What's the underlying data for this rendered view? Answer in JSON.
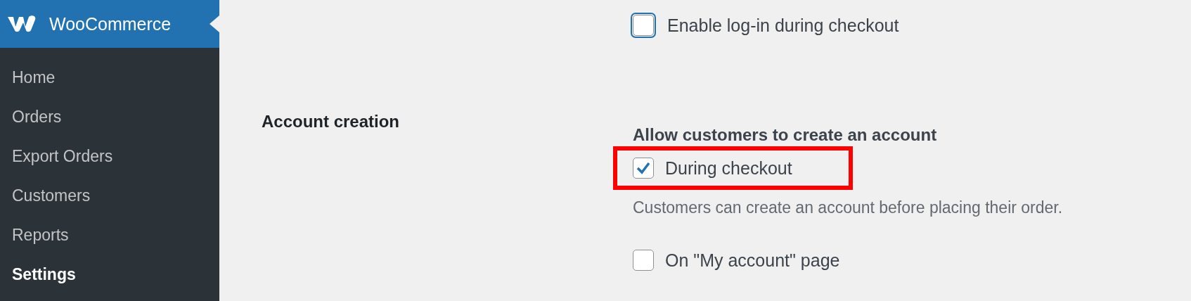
{
  "sidebar": {
    "brand": "WooCommerce",
    "items": [
      {
        "label": "Home",
        "selected": false
      },
      {
        "label": "Orders",
        "selected": false
      },
      {
        "label": "Export Orders",
        "selected": false
      },
      {
        "label": "Customers",
        "selected": false
      },
      {
        "label": "Reports",
        "selected": false
      },
      {
        "label": "Settings",
        "selected": true
      }
    ]
  },
  "top_option": {
    "label": "Enable log-in during checkout",
    "checked": false,
    "focused": true
  },
  "section": {
    "label": "Account creation",
    "heading": "Allow customers to create an account",
    "options": [
      {
        "label": "During checkout",
        "checked": true,
        "highlighted": true,
        "description": "Customers can create an account before placing their order."
      },
      {
        "label": "On \"My account\" page",
        "checked": false,
        "highlighted": false
      }
    ]
  }
}
